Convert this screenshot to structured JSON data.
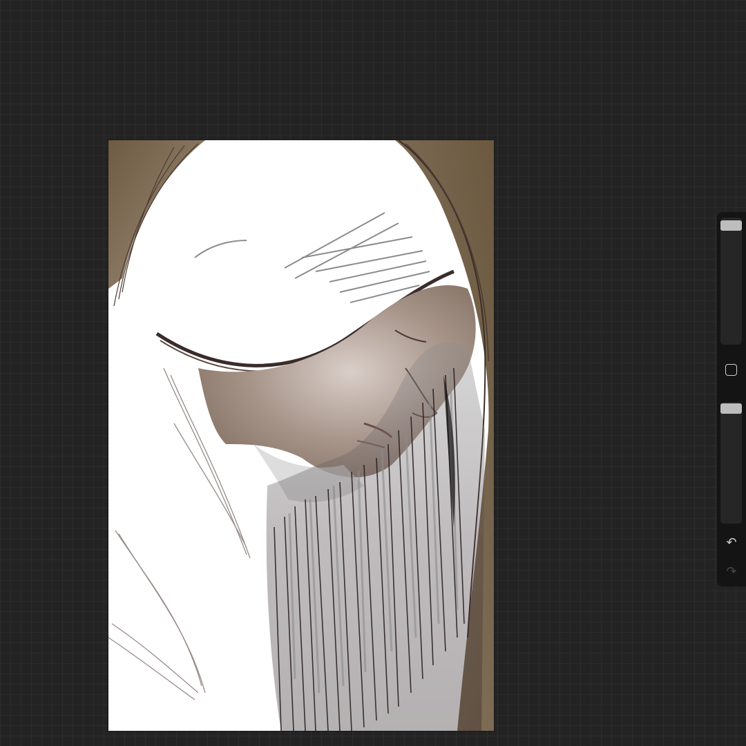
{
  "app": {
    "accent": "#bdbdbd",
    "workspace_color": "#232323",
    "canvas_color": "#ffffff"
  },
  "sidebar": {
    "brush_size_slider": {
      "icon": "slider-thumb",
      "level": 0.97
    },
    "modify_button": {
      "icon": "square-outline-icon"
    },
    "opacity_slider": {
      "icon": "slider-thumb",
      "level": 1.0
    },
    "undo": {
      "icon": "undo-arrow-icon",
      "glyph": "↶"
    },
    "redo": {
      "icon": "redo-arrow-icon",
      "glyph": "↷",
      "enabled": false
    }
  },
  "canvas": {
    "artwork": "sketch-portrait",
    "palette": [
      "#6b5a45",
      "#2a2022",
      "#8a8a8a",
      "#b9a79a"
    ]
  }
}
